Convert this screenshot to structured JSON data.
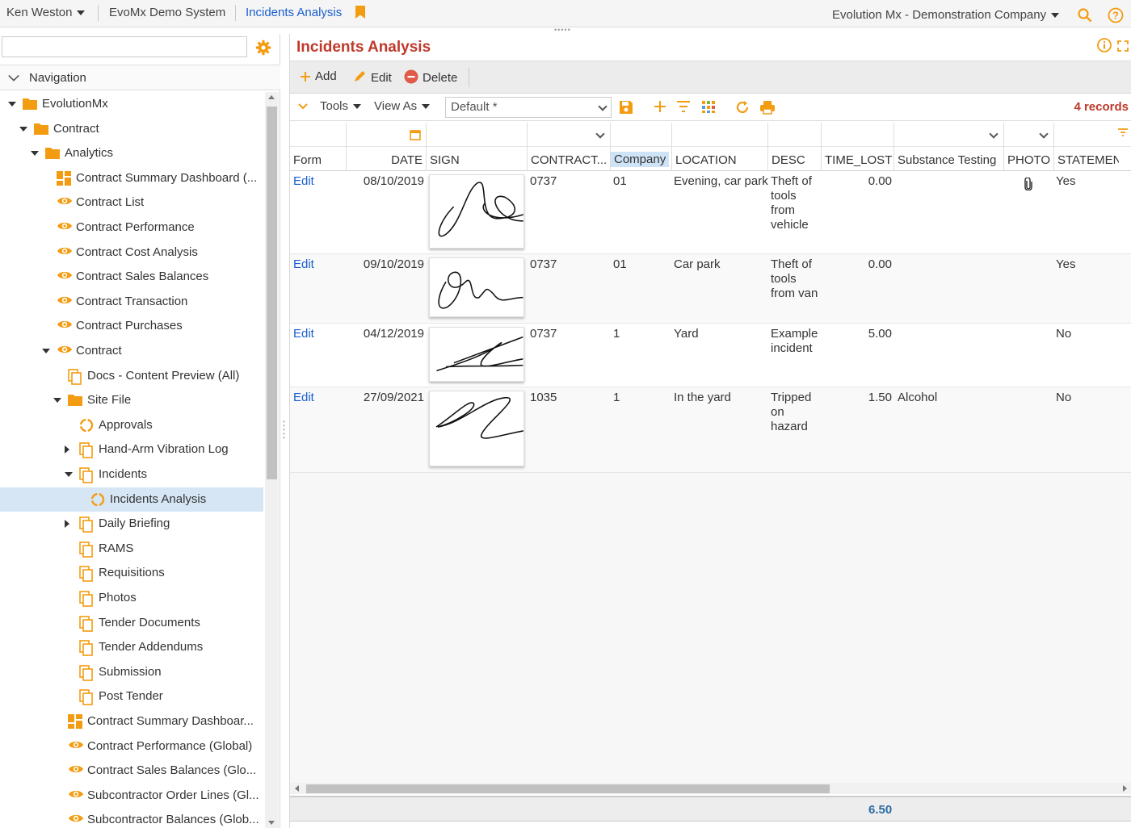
{
  "topbar": {
    "user": "Ken Weston",
    "system": "EvoMx Demo System",
    "current_page": "Incidents Analysis",
    "company": "Evolution Mx - Demonstration Company"
  },
  "colors": {
    "accent": "#f39c12",
    "title_red": "#c0392b",
    "link_blue": "#1a5fd0",
    "selected_bg": "#d6e6f5"
  },
  "navigation": {
    "search_value": "",
    "header": "Navigation",
    "items": [
      {
        "label": "EvolutionMx",
        "icon": "folder-icon",
        "indent": 0,
        "expander": "down"
      },
      {
        "label": "Contract",
        "icon": "folder-icon",
        "indent": 1,
        "expander": "down"
      },
      {
        "label": "Analytics",
        "icon": "folder-icon",
        "indent": 2,
        "expander": "down"
      },
      {
        "label": "Contract Summary Dashboard (...",
        "icon": "dashboard-icon",
        "indent": 3,
        "expander": ""
      },
      {
        "label": "Contract List",
        "icon": "eye-icon",
        "indent": 3,
        "expander": ""
      },
      {
        "label": "Contract Performance",
        "icon": "eye-icon",
        "indent": 3,
        "expander": ""
      },
      {
        "label": "Contract Cost Analysis",
        "icon": "eye-icon",
        "indent": 3,
        "expander": ""
      },
      {
        "label": "Contract Sales Balances",
        "icon": "eye-icon",
        "indent": 3,
        "expander": ""
      },
      {
        "label": "Contract Transaction",
        "icon": "eye-icon",
        "indent": 3,
        "expander": ""
      },
      {
        "label": "Contract Purchases",
        "icon": "eye-icon",
        "indent": 3,
        "expander": ""
      },
      {
        "label": "Contract",
        "icon": "eye-icon",
        "indent": 3,
        "expander": "down"
      },
      {
        "label": "Docs - Content Preview (All)",
        "icon": "pages-icon",
        "indent": 4,
        "expander": ""
      },
      {
        "label": "Site File",
        "icon": "folder-icon",
        "indent": 4,
        "expander": "down"
      },
      {
        "label": "Approvals",
        "icon": "ring-icon",
        "indent": 5,
        "expander": ""
      },
      {
        "label": "Hand-Arm Vibration Log",
        "icon": "pages-icon",
        "indent": 5,
        "expander": "right"
      },
      {
        "label": "Incidents",
        "icon": "pages-icon",
        "indent": 5,
        "expander": "down"
      },
      {
        "label": "Incidents Analysis",
        "icon": "ring-icon",
        "indent": 6,
        "expander": "",
        "selected": true
      },
      {
        "label": "Daily Briefing",
        "icon": "pages-icon",
        "indent": 5,
        "expander": "right"
      },
      {
        "label": "RAMS",
        "icon": "pages-icon",
        "indent": 5,
        "expander": ""
      },
      {
        "label": "Requisitions",
        "icon": "pages-icon",
        "indent": 5,
        "expander": ""
      },
      {
        "label": "Photos",
        "icon": "pages-icon",
        "indent": 5,
        "expander": ""
      },
      {
        "label": "Tender Documents",
        "icon": "pages-icon",
        "indent": 5,
        "expander": ""
      },
      {
        "label": "Tender Addendums",
        "icon": "pages-icon",
        "indent": 5,
        "expander": ""
      },
      {
        "label": "Submission",
        "icon": "pages-icon",
        "indent": 5,
        "expander": ""
      },
      {
        "label": "Post Tender",
        "icon": "pages-icon",
        "indent": 5,
        "expander": ""
      },
      {
        "label": "Contract Summary Dashboar...",
        "icon": "dashboard-icon",
        "indent": 4,
        "expander": ""
      },
      {
        "label": "Contract Performance (Global)",
        "icon": "eye-icon",
        "indent": 4,
        "expander": ""
      },
      {
        "label": "Contract Sales Balances (Glo...",
        "icon": "eye-icon",
        "indent": 4,
        "expander": ""
      },
      {
        "label": "Subcontractor Order Lines (Gl...",
        "icon": "eye-icon",
        "indent": 4,
        "expander": ""
      },
      {
        "label": "Subcontractor Balances (Glob...",
        "icon": "eye-icon",
        "indent": 4,
        "expander": ""
      }
    ]
  },
  "main": {
    "title": "Incidents Analysis",
    "toolbar": {
      "add": "Add",
      "edit": "Edit",
      "delete": "Delete"
    },
    "toolbar2": {
      "tools": "Tools",
      "view_as": "View As",
      "view_value": "Default *",
      "records": "4 records"
    },
    "columns": [
      "Form",
      "DATE",
      "SIGN",
      "CONTRACT...",
      "Company",
      "LOCATION",
      "DESC",
      "TIME_LOST",
      "Substance Testing",
      "PHOTO",
      "STATEMEN"
    ],
    "rows": [
      {
        "form": "Edit",
        "date": "08/10/2019",
        "contract": "0737",
        "company": "01",
        "location": "Evening, car park",
        "desc": "Theft of tools from vehicle",
        "time_lost": "0.00",
        "substance": "",
        "photo": "paperclip-icon",
        "statement": "Yes"
      },
      {
        "form": "Edit",
        "date": "09/10/2019",
        "contract": "0737",
        "company": "01",
        "location": "Car park",
        "desc": "Theft of tools from van",
        "time_lost": "0.00",
        "substance": "",
        "photo": "",
        "statement": "Yes"
      },
      {
        "form": "Edit",
        "date": "04/12/2019",
        "contract": "0737",
        "company": "1",
        "location": "Yard",
        "desc": "Example incident",
        "time_lost": "5.00",
        "substance": "",
        "photo": "",
        "statement": "No"
      },
      {
        "form": "Edit",
        "date": "27/09/2021",
        "contract": "1035",
        "company": "1",
        "location": "In the yard",
        "desc": "Tripped on hazard",
        "time_lost": "1.50",
        "substance": "Alcohol",
        "photo": "",
        "statement": "No"
      }
    ],
    "footer_total": "6.50"
  }
}
